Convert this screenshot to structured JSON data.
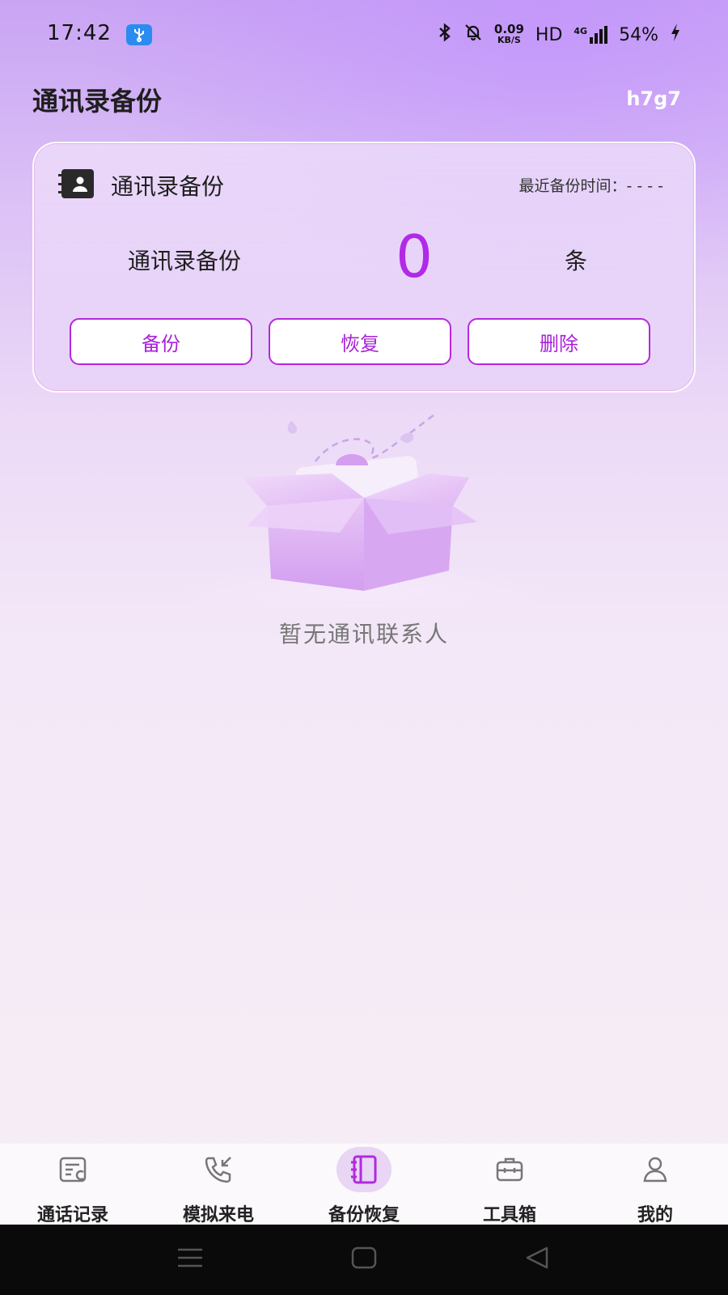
{
  "status_bar": {
    "time": "17:42",
    "usb_icon": "usb-icon",
    "net_speed_value": "0.09",
    "net_speed_unit": "KB/S",
    "hd": "HD",
    "network": "4G",
    "battery": "54%"
  },
  "header": {
    "title": "通讯录备份",
    "right_text": "h7g7"
  },
  "card": {
    "title": "通讯录备份",
    "last_backup": "最近备份时间：- - - -",
    "count_label": "通讯录备份",
    "count_value": "0",
    "count_unit": "条",
    "buttons": {
      "backup": "备份",
      "restore": "恢复",
      "delete": "删除"
    }
  },
  "empty_state": {
    "text": "暂无通讯联系人"
  },
  "bottom_nav": {
    "items": [
      {
        "label": "通话记录"
      },
      {
        "label": "模拟来电"
      },
      {
        "label": "备份恢复"
      },
      {
        "label": "工具箱"
      },
      {
        "label": "我的"
      }
    ],
    "active_index": 2
  },
  "colors": {
    "accent": "#b02ae8",
    "button_border": "#b529dc"
  }
}
